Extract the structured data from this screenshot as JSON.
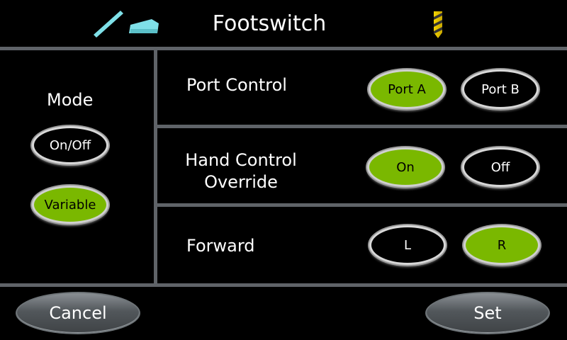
{
  "header": {
    "title": "Footswitch",
    "icons": [
      "handpiece-icon",
      "footswitch-icon",
      "drill-bit-icon"
    ]
  },
  "mode": {
    "label": "Mode",
    "options": [
      "On/Off",
      "Variable"
    ],
    "selected": "Variable"
  },
  "port_control": {
    "label": "Port Control",
    "options": [
      "Port A",
      "Port B"
    ],
    "selected": "Port A"
  },
  "hand_control": {
    "label_line1": "Hand Control",
    "label_line2": "Override",
    "options": [
      "On",
      "Off"
    ],
    "selected": "On"
  },
  "forward": {
    "label": "Forward",
    "options": [
      "L",
      "R"
    ],
    "selected": "R"
  },
  "footer": {
    "cancel_label": "Cancel",
    "set_label": "Set"
  },
  "colors": {
    "selected": "#7ab800",
    "divider": "#5f6368",
    "background": "#000000"
  }
}
